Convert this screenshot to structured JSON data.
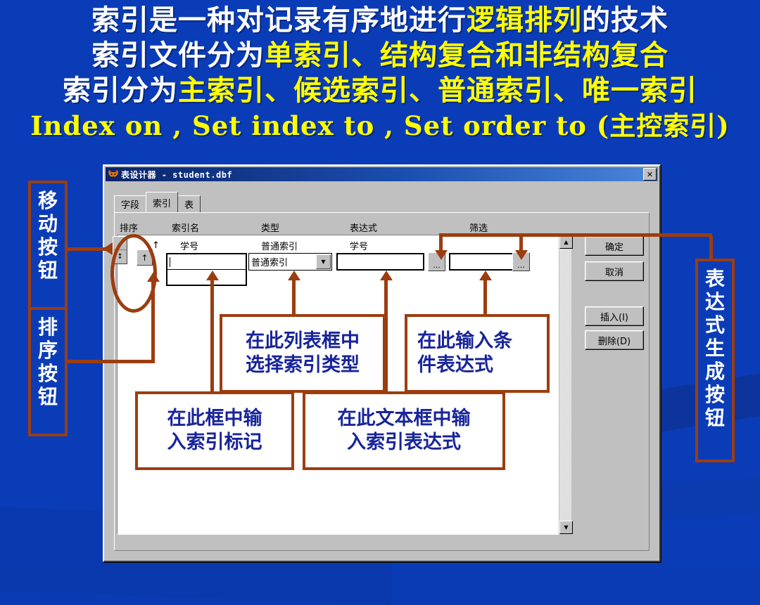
{
  "slide": {
    "background_color": "#0b3cb8",
    "heading_lines": [
      {
        "segments": [
          {
            "text": "索引是一种对记录有序地进行",
            "color": "white"
          },
          {
            "text": "逻辑排列",
            "color": "yellow"
          },
          {
            "text": "的技术",
            "color": "white"
          }
        ]
      },
      {
        "segments": [
          {
            "text": "索引文件分为",
            "color": "white"
          },
          {
            "text": "单索引、结构复合和非结构复合",
            "color": "yellow"
          }
        ]
      },
      {
        "segments": [
          {
            "text": "索引分为",
            "color": "white"
          },
          {
            "text": "主索引、候选索引、普通索引、唯一索引",
            "color": "yellow"
          }
        ]
      },
      {
        "segments": [
          {
            "text": "Index  on , Set index  to ,  Set  order  to (主控索引)",
            "color": "yellow"
          }
        ]
      }
    ],
    "line1_white_a": "索引是一种对记录有序地进行",
    "line1_yellow": "逻辑排列",
    "line1_white_b": "的技术",
    "line2_white": "索引文件分为",
    "line2_yellow": "单索引、结构复合和非结构复合",
    "line3_white": "索引分为",
    "line3_yellow": "主索引、候选索引、普通索引、唯一索引",
    "line4": "Index  on , Set index  to ,  Set  order  to (主控索引)"
  },
  "dialog": {
    "title": "表设计器 - student.dbf",
    "icon": "foxpro-icon",
    "close_label": "✕",
    "tabs": [
      {
        "label": "字段",
        "selected": false
      },
      {
        "label": "索引",
        "selected": true
      },
      {
        "label": "表",
        "selected": false
      }
    ],
    "grid": {
      "columns": [
        "排序",
        "索引名",
        "类型",
        "表达式",
        "筛选"
      ],
      "row": {
        "sort_mark": "↑",
        "index_name": "学号",
        "type": "普通索引",
        "expression": "学号",
        "filter": ""
      },
      "editing": {
        "index_name_value": "",
        "type_value": "普通索引",
        "expression_value": "",
        "filter_value": "",
        "expression_builder_label": "...",
        "filter_builder_label": "..."
      },
      "move_handle_glyph": "↕",
      "sort_button_glyph": "↑",
      "scroll_up_glyph": "▲",
      "scroll_down_glyph": "▼",
      "combo_arrow_glyph": "▼"
    },
    "buttons": [
      {
        "label": "确定",
        "name": "ok-button"
      },
      {
        "label": "取消",
        "name": "cancel-button"
      },
      {
        "label": "插入(I)",
        "name": "insert-button"
      },
      {
        "label": "删除(D)",
        "name": "delete-button"
      }
    ]
  },
  "annotations": {
    "left_labels": [
      {
        "text": "移动按钮",
        "chars": [
          "移",
          "动",
          "按",
          "钮"
        ]
      },
      {
        "text": "排序按钮",
        "chars": [
          "排",
          "序",
          "按",
          "钮"
        ]
      }
    ],
    "right_label": {
      "text": "表达式生成按钮",
      "chars": [
        "表",
        "达",
        "式",
        "生",
        "成",
        "按",
        "钮"
      ]
    },
    "notes": [
      {
        "line1": "在此列表框中",
        "line2": "选择索引类型",
        "name": "note-select-index-type"
      },
      {
        "line1": "在此输入条",
        "line2": "件表达式",
        "name": "note-enter-filter-expression"
      },
      {
        "line1": "在此框中输",
        "line2": "入索引标记",
        "name": "note-enter-index-tag"
      },
      {
        "line1": "在此文本框中输",
        "line2": "入索引表达式",
        "name": "note-enter-index-expression"
      }
    ],
    "accent_color": "#9c3d10",
    "note_text_color": "#18249a"
  }
}
